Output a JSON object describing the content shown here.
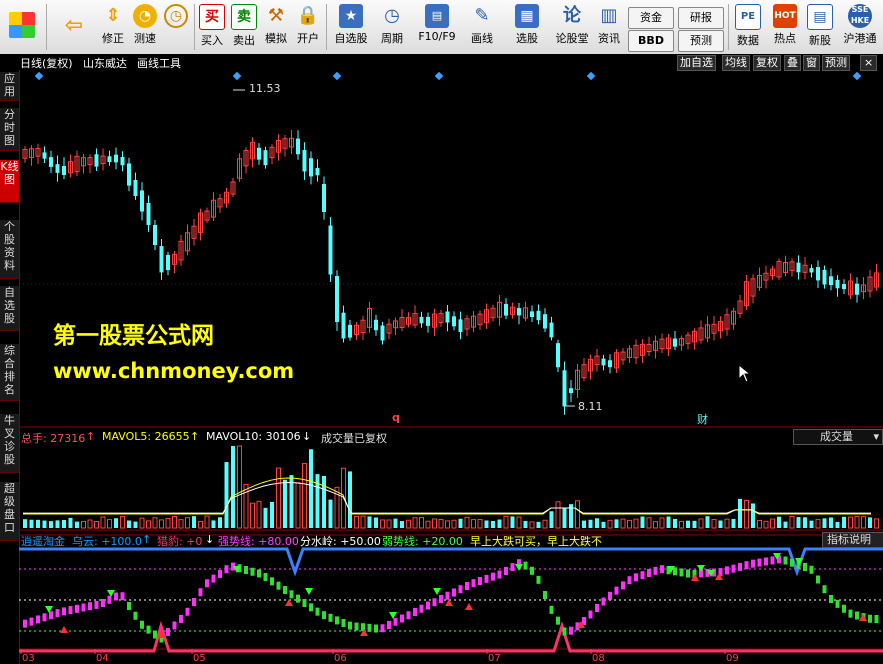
{
  "toolbar": {
    "items": [
      {
        "label": "",
        "icon": "windows-logo-icon"
      },
      {
        "label": "",
        "icon": "back-arrow-icon"
      },
      {
        "label": "修正",
        "icon": "revise-icon"
      },
      {
        "label": "测速",
        "icon": "speed-test-icon"
      },
      {
        "label": "买入",
        "icon": "buy-icon",
        "glyph": "买"
      },
      {
        "label": "卖出",
        "icon": "sell-icon",
        "glyph": "卖"
      },
      {
        "label": "模拟",
        "icon": "simulate-icon"
      },
      {
        "label": "开户",
        "icon": "open-account-icon"
      },
      {
        "label": "自选股",
        "icon": "watchlist-icon"
      },
      {
        "label": "周期",
        "icon": "period-icon"
      },
      {
        "label": "F10/F9",
        "icon": "f10-icon"
      },
      {
        "label": "画线",
        "icon": "draw-line-icon"
      },
      {
        "label": "选股",
        "icon": "stock-picker-icon"
      },
      {
        "label": "论股堂",
        "icon": "forum-icon",
        "glyph": "论"
      },
      {
        "label": "资讯",
        "icon": "news-icon"
      },
      {
        "label": "数据",
        "icon": "data-icon"
      },
      {
        "label": "热点",
        "icon": "hotspot-icon"
      },
      {
        "label": "新股",
        "icon": "new-stock-icon"
      },
      {
        "label": "沪港通",
        "icon": "hk-connect-icon"
      }
    ],
    "box_buttons": {
      "fund": "资金",
      "bbd": "BBD",
      "research": "研报",
      "forecast": "预测"
    }
  },
  "sidebar": {
    "tabs": [
      "应用",
      "分时图",
      "K线图",
      "个股资料",
      "自选股",
      "综合排名",
      "牛叉诊股",
      "超级盘口"
    ],
    "active_index": 2
  },
  "chart_header": {
    "title": "日线(复权)",
    "stock_name": "山东威达",
    "tool": "画线工具",
    "buttons": [
      "加自选",
      "均线",
      "复权",
      "叠",
      "窗",
      "预测"
    ]
  },
  "watermark": {
    "line1": "第一股票公式网",
    "line2": "www.chnmoney.com"
  },
  "price_panel": {
    "high_label": "11.53",
    "low_label": "8.11",
    "marker_q": "q",
    "marker_cai": "财"
  },
  "volume_panel": {
    "total_label": "总手: 27316",
    "mavol5_label": "MAVOL5: 26655",
    "mavol10_label": "MAVOL10: 30106",
    "note": "成交量已复权",
    "selector": "成交量",
    "colors": {
      "total": "#ff5050",
      "mavol5": "#ffff00",
      "mavol10": "#ffffff"
    }
  },
  "indicator_panel": {
    "name": "逍遥淘金",
    "items": [
      {
        "text": "乌云: +100.0",
        "color": "#00a0ff",
        "arrow": "↑"
      },
      {
        "text": "猎豹: +0",
        "color": "#ff3070",
        "arrow": "↓"
      },
      {
        "text": "强势线: +80.00",
        "color": "#ff40ff",
        "arrow": ""
      },
      {
        "text": "分水岭: +50.00",
        "color": "#ffffff",
        "arrow": ""
      },
      {
        "text": "弱势线: +20.00",
        "color": "#40ff40",
        "arrow": ""
      },
      {
        "text": "早上大跌可买，早上大跌不",
        "color": "#ffff40",
        "arrow": ""
      }
    ],
    "help_button": "指标说明"
  },
  "x_axis": {
    "ticks": [
      "03",
      "04",
      "05",
      "06",
      "07",
      "08",
      "09"
    ]
  },
  "colors": {
    "up": "#ff4040",
    "down": "#54ffff",
    "grid": "#8b0000"
  },
  "chart_data": {
    "type": "candlestick",
    "price_extremes": {
      "high": 11.53,
      "low": 8.11
    },
    "volume_summary": {
      "total": 27316,
      "mavol5": 26655,
      "mavol10": 30106
    },
    "indicator_levels": {
      "乌云": 100.0,
      "猎豹": 0,
      "强势线": 80.0,
      "分水岭": 50.0,
      "弱势线": 20.0
    },
    "x_ticks": [
      "03",
      "04",
      "05",
      "06",
      "07",
      "08",
      "09"
    ]
  }
}
